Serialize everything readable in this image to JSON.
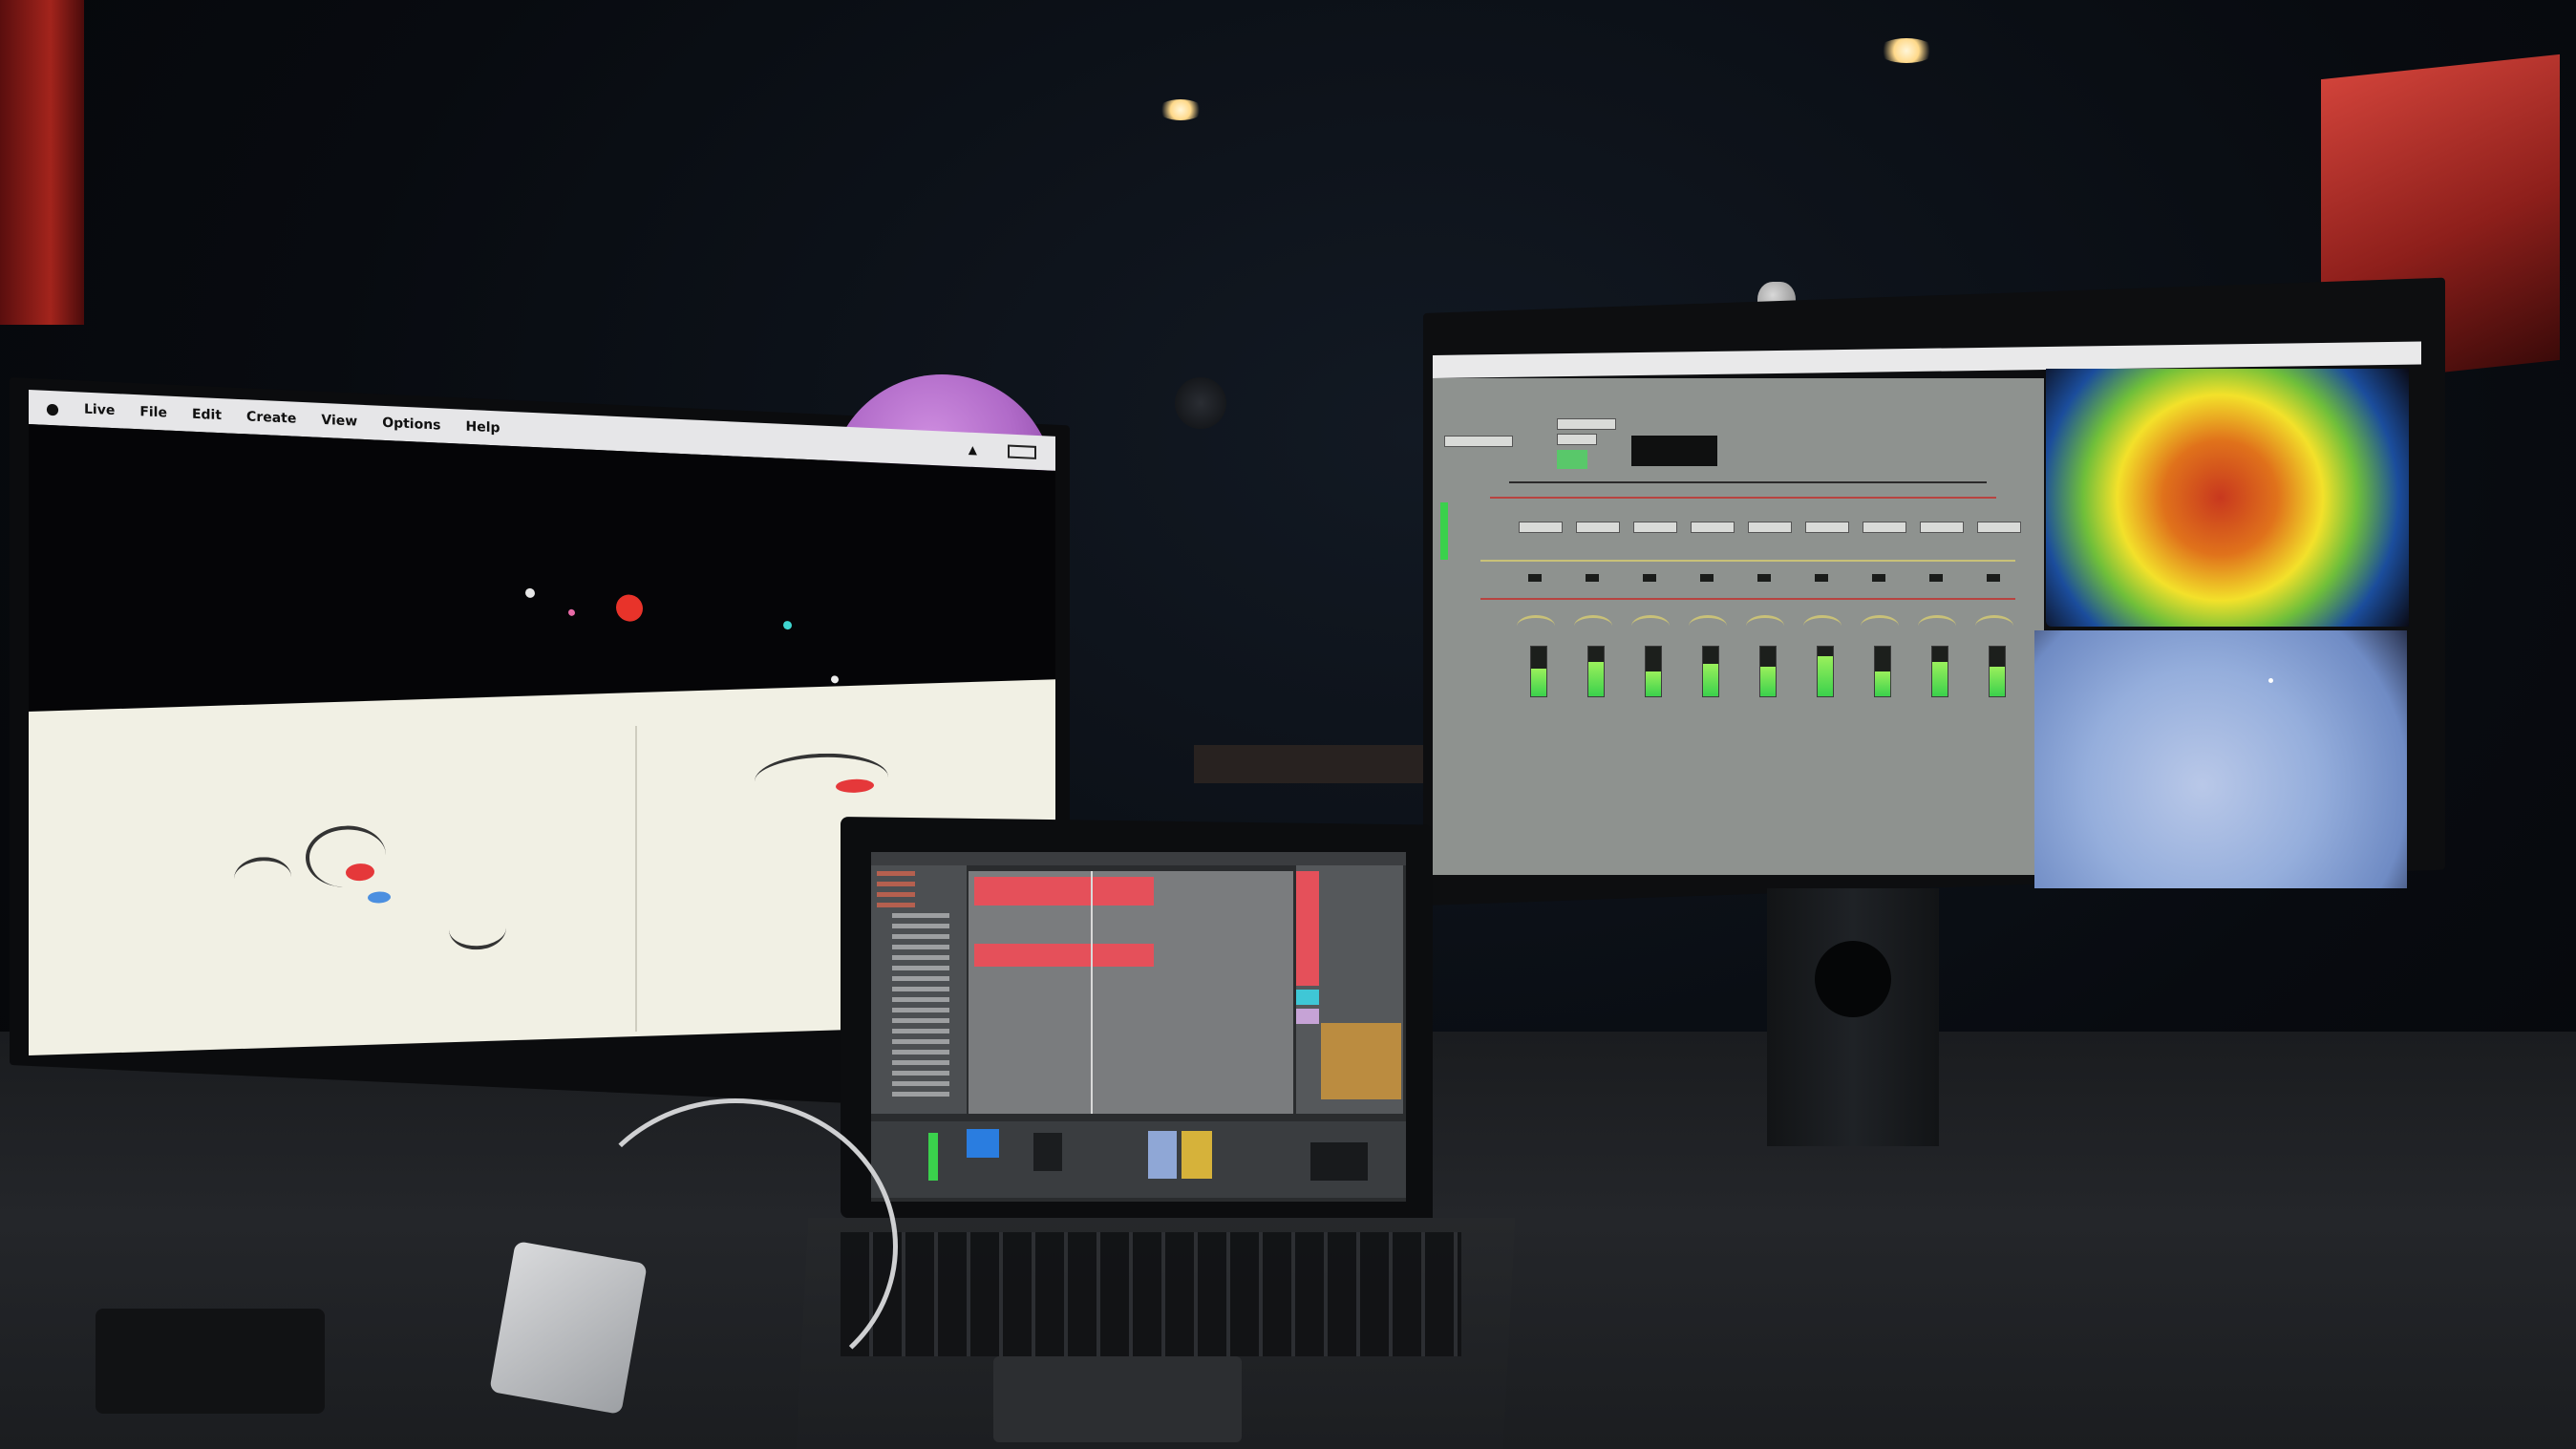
{
  "left_monitor": {
    "menu": [
      "Live",
      "File",
      "Edit",
      "Create",
      "View",
      "Options",
      "Help"
    ]
  },
  "colors": {
    "ableton_clip": "#e5505a",
    "max_meter": "#3ad14c",
    "pink_planet": "#b06ac8",
    "speaker": "#a3241c"
  },
  "icons": [
    "apple-icon",
    "wifi-icon",
    "battery-icon"
  ]
}
